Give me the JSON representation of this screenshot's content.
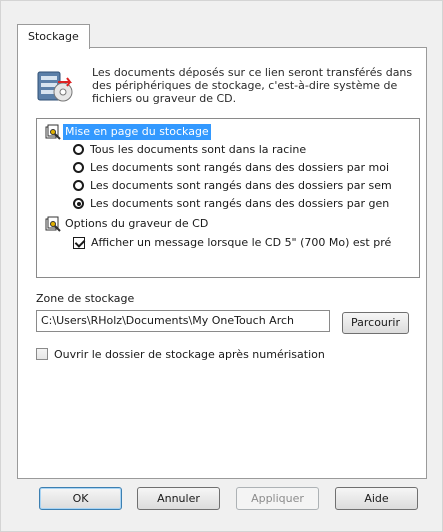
{
  "tab": {
    "label": "Stockage"
  },
  "header": {
    "description": "Les documents déposés sur ce lien seront transférés dans des périphériques de stockage, c'est-à-dire système de fichiers ou graveur de CD."
  },
  "tree": {
    "layout_group": {
      "label": "Mise en page du stockage",
      "selected": true,
      "options": [
        {
          "label": "Tous les documents sont dans la racine",
          "checked": false
        },
        {
          "label": "Les documents sont rangés dans des dossiers par moi",
          "checked": false
        },
        {
          "label": "Les documents sont rangés dans des dossiers par sem",
          "checked": false
        },
        {
          "label": "Les documents sont rangés dans des dossiers par gen",
          "checked": true
        }
      ]
    },
    "cd_group": {
      "label": "Options du graveur de CD",
      "option": {
        "label": "Afficher un message lorsque le CD 5\" (700 Mo) est pré",
        "checked": true
      }
    }
  },
  "storage_zone": {
    "label": "Zone de stockage",
    "path": "C:\\Users\\RHolz\\Documents\\My OneTouch Arch",
    "browse_label": "Parcourir"
  },
  "open_folder": {
    "label": "Ouvrir le dossier de stockage après numérisation",
    "checked": false
  },
  "buttons": {
    "ok": "OK",
    "cancel": "Annuler",
    "apply": "Appliquer",
    "help": "Aide"
  },
  "colors": {
    "selection": "#3399ff",
    "panel_bg": "#ffffff",
    "dialog_bg": "#f0f0f0"
  }
}
